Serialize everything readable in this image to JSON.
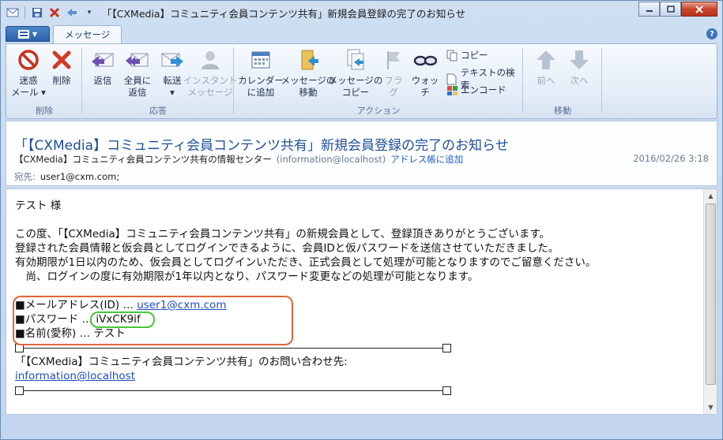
{
  "window": {
    "title": "「【CXMedia】コミュニティ会員コンテンツ共有」新規会員登録の完了のお知らせ"
  },
  "ribbon": {
    "file_label": "▼",
    "tab_message": "メッセージ",
    "groups": {
      "delete": {
        "label": "削除",
        "junk": "迷惑\nメール ▾",
        "delete": "削除"
      },
      "respond": {
        "label": "応答",
        "reply": "返信",
        "reply_all": "全員に\n返信",
        "forward": "転送\n▾",
        "im": "インスタント\nメッセージ"
      },
      "actions": {
        "label": "アクション",
        "calendar": "カレンダー\nに追加",
        "move": "メッセージの\n移動",
        "copy": "メッセージの\nコピー",
        "flag": "フラグ",
        "watch": "ウォッチ",
        "copy_small": "コピー",
        "find_text": "テキストの検索",
        "encode": "エンコード"
      },
      "move": {
        "label": "移動",
        "prev": "前へ",
        "next": "次へ"
      }
    }
  },
  "message": {
    "subject": "「【CXMedia】コミュニティ会員コンテンツ共有」新規会員登録の完了のお知らせ",
    "from_name": "【CXMedia】コミュニティ会員コンテンツ共有の情報センター",
    "from_email": "(information@localhost)",
    "add_to_contacts": "アドレス帳に追加",
    "date": "2016/02/26 3:18",
    "to_label": "宛先:",
    "to_value": "user1@cxm.com;",
    "body": {
      "greeting": "テスト 様",
      "p1": "この度、「【CXMedia】コミュニティ会員コンテンツ共有」の新規会員として、登録頂きありがとうございます。",
      "p2": "登録された会員情報と仮会員としてログインできるように、会員IDと仮パスワードを送信させていただきました。",
      "p3": "有効期限が1日以内のため、仮会員としてログインいただき、正式会員として処理が可能となりますのでご留意ください。",
      "p4": "　尚、ログインの度に有効期限が1年以内となり、パスワード変更などの処理が可能となります。",
      "email_label": "■メールアドレス(ID) … ",
      "email_value": "user1@cxm.com",
      "password_label": "■パスワード … ",
      "password_value": "iVxCK9if",
      "name_label": "■名前(愛称) … ",
      "name_value": "テスト",
      "contact_line": "「【CXMedia】コミュニティ会員コンテンツ共有」のお問い合わせ先:",
      "contact_email": "information@localhost"
    }
  },
  "colors": {
    "highlight_red": "#e0663a",
    "highlight_green": "#46c83a",
    "link": "#1f4fbf",
    "subject": "#1f4e9a"
  }
}
